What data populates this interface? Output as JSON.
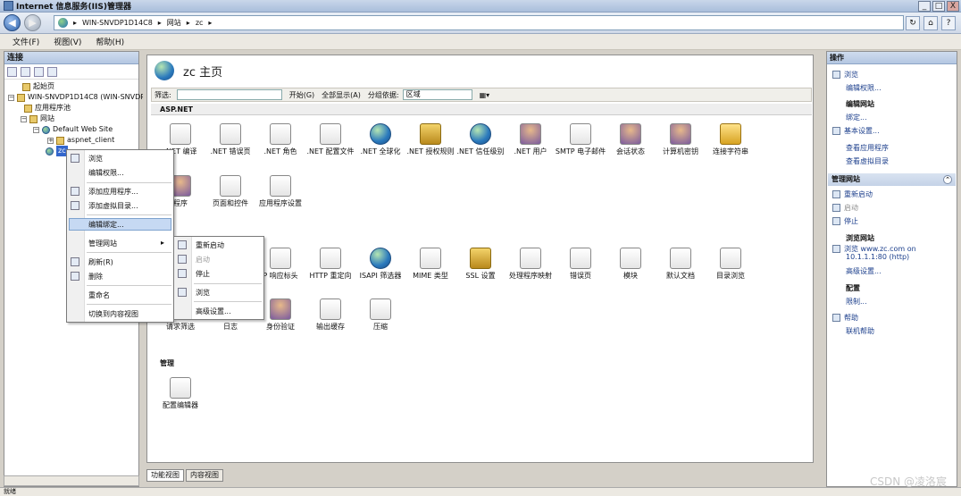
{
  "window": {
    "title": "Internet 信息服务(IIS)管理器",
    "controls": [
      "_",
      "□",
      "X"
    ]
  },
  "address": {
    "segments": [
      "WIN-SNVDP1D14C8",
      "网站",
      "zc"
    ],
    "right_icons": [
      "refresh-icon",
      "home-icon",
      "help-icon"
    ]
  },
  "menu": [
    "文件(F)",
    "视图(V)",
    "帮助(H)"
  ],
  "connections": {
    "title": "连接",
    "tree": [
      {
        "label": "起始页"
      },
      {
        "label": "WIN-SNVDP1D14C8 (WIN-SNVDP"
      },
      {
        "label": "应用程序池"
      },
      {
        "label": "网站"
      },
      {
        "label": "Default Web Site"
      },
      {
        "label": "aspnet_client"
      },
      {
        "label": "zc"
      }
    ]
  },
  "page": {
    "title": "zc 主页"
  },
  "filter": {
    "label": "筛选:",
    "start": "开始(G)",
    "showall": "全部显示(A)",
    "groupby": "分组依据:",
    "group_value": "区域"
  },
  "sections": {
    "aspnet": "ASP.NET",
    "iis": "IIS",
    "manage": "管理"
  },
  "aspnet_icons": [
    ".NET 编译",
    ".NET 错误页",
    ".NET 角色",
    ".NET 配置文件",
    ".NET 全球化",
    ".NET 授权规则",
    ".NET 信任级别",
    ".NET 用户",
    "SMTP 电子邮件",
    "会话状态",
    "计算机密钥",
    "连接字符串",
    "程序",
    "页面和控件",
    "应用程序设置"
  ],
  "iis_icons": [
    "P 响应标头",
    "HTTP 重定向",
    "ISAPI 筛选器",
    "MIME 类型",
    "SSL 设置",
    "处理程序映射",
    "错误页",
    "模块",
    "默认文档",
    "目录浏览",
    "请求筛选",
    "日志",
    "身份验证",
    "输出缓存",
    "压缩"
  ],
  "manage_icons": [
    "配置编辑器"
  ],
  "tabs": [
    "功能视图",
    "内容视图"
  ],
  "context_menu": [
    "浏览",
    "编辑权限...",
    "添加应用程序...",
    "添加虚拟目录...",
    "编辑绑定...",
    "管理网站",
    "刷新(R)",
    "删除",
    "重命名",
    "切换到内容视图"
  ],
  "submenu": [
    "重新启动",
    "启动",
    "停止",
    "浏览",
    "高级设置..."
  ],
  "actions": {
    "title": "操作",
    "browse": "浏览",
    "edit_perm": "编辑权限...",
    "edit_site": "编辑网站",
    "bind": "绑定...",
    "basic": "基本设置...",
    "view_apps": "查看应用程序",
    "view_vdirs": "查看虚拟目录",
    "manage_site": "管理网站",
    "restart": "重新启动",
    "start": "启动",
    "stop": "停止",
    "browse_site": "浏览网站",
    "browse_host": "浏览 www.zc.com on",
    "browse_host2": "10.1.1.1:80 (http)",
    "advanced": "高级设置...",
    "config": "配置",
    "limits": "限制...",
    "help": "帮助",
    "online_help": "联机帮助"
  },
  "status": "就绪",
  "watermark": "CSDN @凌洛宸"
}
